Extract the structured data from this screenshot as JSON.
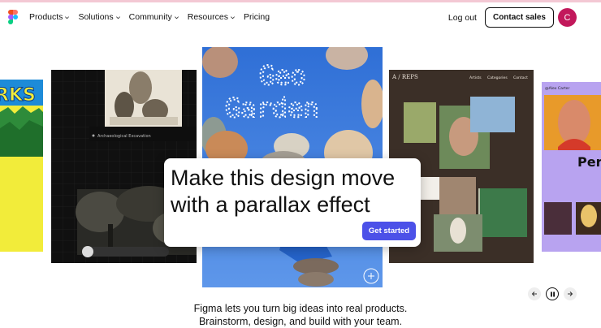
{
  "nav": {
    "menu": [
      {
        "label": "Products"
      },
      {
        "label": "Solutions"
      },
      {
        "label": "Community"
      },
      {
        "label": "Resources"
      },
      {
        "label": "Pricing"
      }
    ],
    "login_label": "Log out",
    "contact_label": "Contact sales",
    "avatar_initial": "C"
  },
  "carousel": {
    "card1_text": "RKS",
    "card2_caption1": "Archaeological Excavation",
    "card3_title_line1": "Geo",
    "card3_title_line2": "Garden",
    "card4_brand": "A / REPS",
    "card4_links": [
      "Artists",
      "Categories",
      "Contact"
    ],
    "card5_author": "@Alex Carter",
    "card5_text": "Pers"
  },
  "prompt": {
    "line1": "Make this design move",
    "line2": "with a parallax effect",
    "cta_label": "Get started"
  },
  "tagline": {
    "line1": "Figma lets you turn big ideas into real products.",
    "line2": "Brainstorm, design, and build with your team."
  },
  "colors": {
    "accent": "#4c51e8",
    "avatar": "#c2185b",
    "topline": "#f3c8d4"
  }
}
